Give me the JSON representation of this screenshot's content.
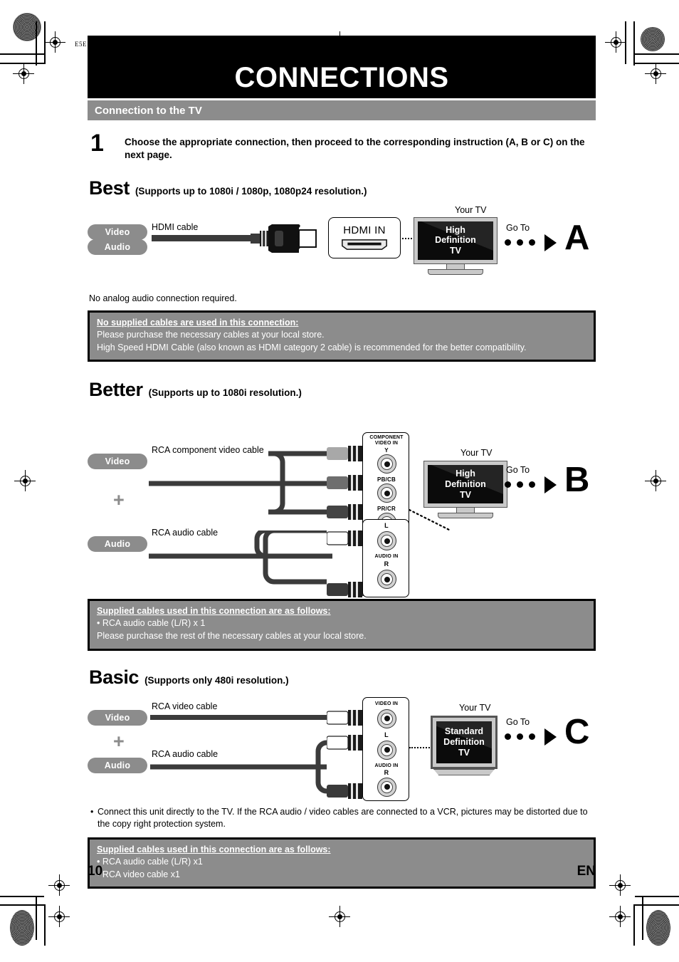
{
  "page": {
    "title": "CONNECTIONS",
    "section_heading": "Connection to the TV",
    "edge_code": "E5E",
    "page_number": "10",
    "language_code": "EN"
  },
  "step": {
    "number": "1",
    "text": "Choose the appropriate connection, then proceed to the corresponding instruction (A, B or C) on the next page."
  },
  "best": {
    "grade": "Best",
    "note": "(Supports up to 1080i / 1080p, 1080p24 resolution.)",
    "pill_video": "Video",
    "pill_audio": "Audio",
    "cable_label": "HDMI cable",
    "jack_label": "HDMI IN",
    "tv_caption": "Your TV",
    "tv_screen_text": "High Definition TV",
    "tv_screen_line1": "High",
    "tv_screen_line2": "Definition",
    "tv_screen_line3": "TV",
    "goto_label": "Go To",
    "target_letter": "A",
    "footnote": "No analog audio connection required.",
    "box_head": "No supplied cables are used in this connection:",
    "box_line1": "Please purchase the necessary cables at your local store.",
    "box_line2": "High Speed HDMI Cable (also known as HDMI category 2 cable) is recommended for the better compatibility."
  },
  "better": {
    "grade": "Better",
    "note": "(Supports up to 1080i resolution.)",
    "pill_video": "Video",
    "pill_audio": "Audio",
    "plus": "+",
    "video_cable_label": "RCA component video cable",
    "audio_cable_label": "RCA audio cable",
    "component_panel_label_line1": "COMPONENT",
    "component_panel_label_line2": "VIDEO IN",
    "jack_y": "Y",
    "jack_pb": "PB/CB",
    "jack_pr": "PR/CR",
    "audio_panel_label": "AUDIO IN",
    "jack_l": "L",
    "jack_r": "R",
    "tv_caption": "Your TV",
    "tv_screen_line1": "High",
    "tv_screen_line2": "Definition",
    "tv_screen_line3": "TV",
    "goto_label": "Go To",
    "target_letter": "B",
    "box_head": "Supplied cables used in this connection are as follows:",
    "box_line1": "• RCA audio cable (L/R) x 1",
    "box_line2": "Please purchase the rest of the necessary cables at your local store."
  },
  "basic": {
    "grade": "Basic",
    "note": "(Supports only 480i resolution.)",
    "pill_video": "Video",
    "pill_audio": "Audio",
    "plus": "+",
    "video_cable_label": "RCA video cable",
    "audio_cable_label": "RCA audio cable",
    "video_panel_label": "VIDEO IN",
    "audio_panel_label": "AUDIO IN",
    "jack_l": "L",
    "jack_r": "R",
    "tv_caption": "Your TV",
    "tv_screen_line1": "Standard",
    "tv_screen_line2": "Definition",
    "tv_screen_line3": "TV",
    "goto_label": "Go To",
    "target_letter": "C",
    "bullet": "•",
    "bullet_text": "Connect this unit directly to the TV. If the RCA audio / video cables are connected to a VCR, pictures may be distorted due to the copy right protection system.",
    "box_head": "Supplied cables used in this connection are as follows:",
    "box_line1": "• RCA audio cable (L/R) x1",
    "box_line2": "• RCA video cable x1"
  },
  "colors": {
    "gray_band": "#8c8c8c",
    "black": "#000000",
    "white": "#ffffff"
  }
}
